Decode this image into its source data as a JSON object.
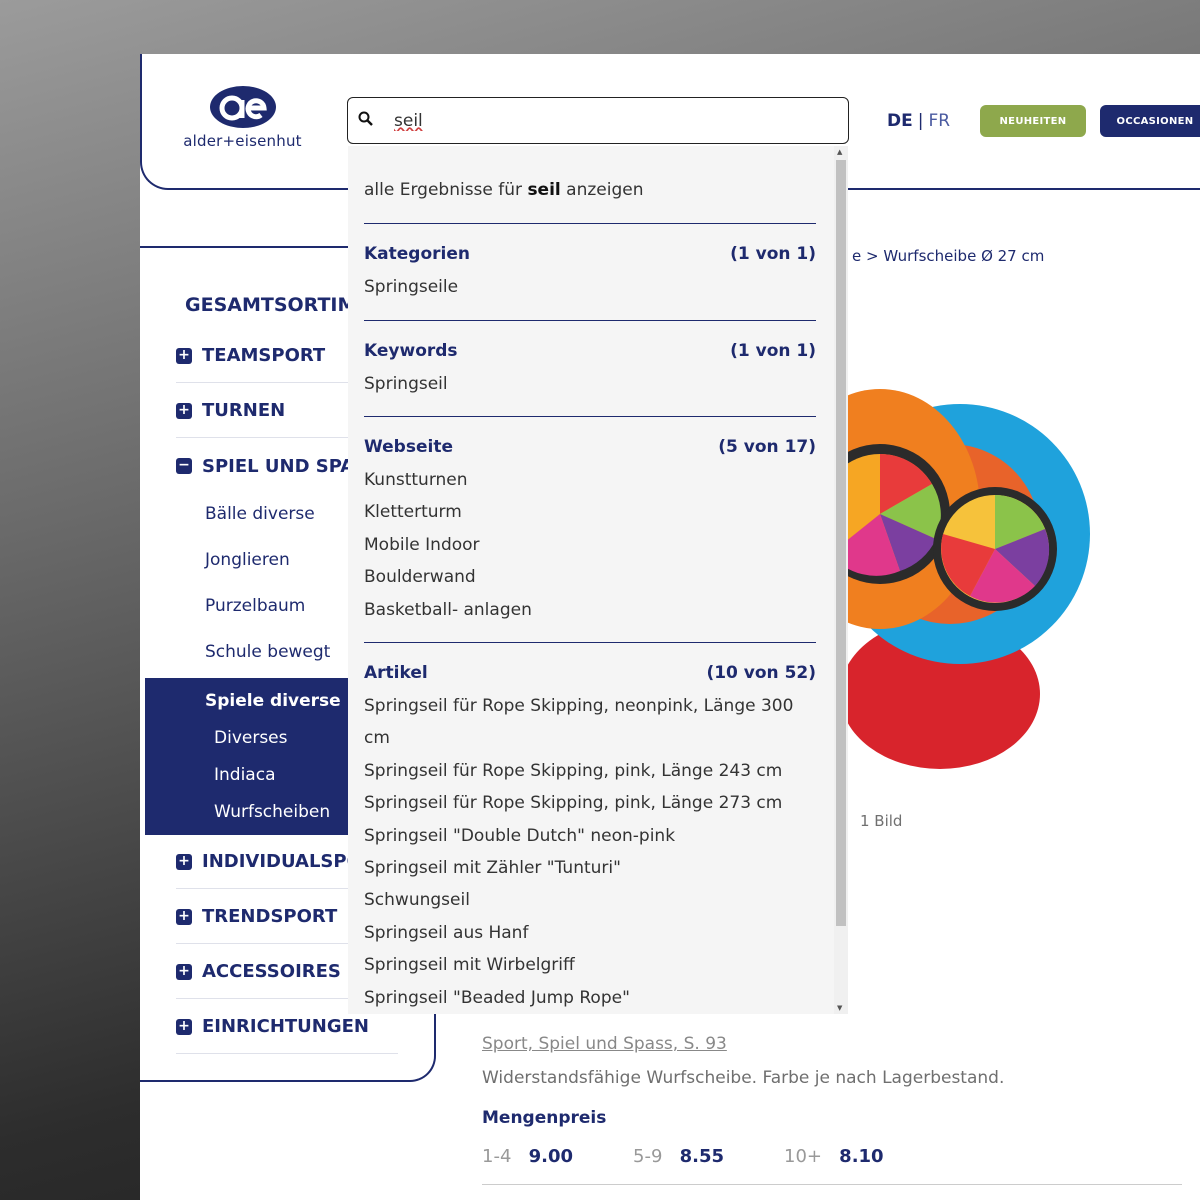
{
  "header": {
    "logo_text": "alder+eisenhut",
    "lang_de": "DE",
    "lang_sep": "|",
    "lang_fr": "FR",
    "btn_new": "NEUHEITEN",
    "btn_occ": "OCCASIONEN"
  },
  "search": {
    "value": "seil",
    "all_prefix": "alle Ergebnisse für ",
    "all_term": "seil",
    "all_suffix": " anzeigen",
    "sections": {
      "kategorien": {
        "title": "Kategorien",
        "count": "(1 von 1)",
        "items": [
          "Springseile"
        ]
      },
      "keywords": {
        "title": "Keywords",
        "count": "(1 von 1)",
        "items": [
          "Springseil"
        ]
      },
      "webseite": {
        "title": "Webseite",
        "count": "(5 von 17)",
        "items": [
          "Kunstturnen",
          "Kletterturm",
          "Mobile Indoor",
          "Boulderwand",
          "Basketball- anlagen"
        ]
      },
      "artikel": {
        "title": "Artikel",
        "count": "(10 von 52)",
        "items": [
          "Springseil für Rope Skipping, neonpink, Länge 300",
          "cm",
          "Springseil für Rope Skipping, pink, Länge 243 cm",
          "Springseil für Rope Skipping, pink, Länge 273 cm",
          "Springseil \"Double Dutch\" neon-pink",
          "Springseil mit Zähler \"Tunturi\"",
          "Schwungseil",
          "Springseil aus Hanf",
          "Springseil mit Wirbelgriff",
          "Springseil \"Beaded Jump Rope\""
        ]
      }
    }
  },
  "nav": {
    "title": "GESAMTSORTIMENT",
    "teamsport": "TEAMSPORT",
    "turnen": "TURNEN",
    "spiel": "SPIEL UND SPASS",
    "sub": [
      "Bälle diverse",
      "Jonglieren",
      "Purzelbaum",
      "Schule bewegt"
    ],
    "active": "Spiele diverse",
    "active_sub": [
      "Diverses",
      "Indiaca",
      "Wurfscheiben"
    ],
    "individual": "INDIVIDUALSPORT",
    "trendsport": "TRENDSPORT",
    "accessoires": "ACCESSOIRES",
    "einrichtungen": "EINRICHTUNGEN"
  },
  "content": {
    "breadcrumb": "e > Wurfscheibe Ø 27 cm",
    "image_count": "1 Bild",
    "source_link": "Sport, Spiel und Spass, S. 93",
    "description": "Widerstandsfähige Wurfscheibe. Farbe je nach Lagerbestand.",
    "price_title": "Mengenpreis",
    "prices": [
      {
        "qty": "1-4",
        "price": "9.00"
      },
      {
        "qty": "5-9",
        "price": "8.55"
      },
      {
        "qty": "10+",
        "price": "8.10"
      }
    ]
  },
  "colors": {
    "brand": "#1e2a6e",
    "green": "#8ea84c"
  }
}
